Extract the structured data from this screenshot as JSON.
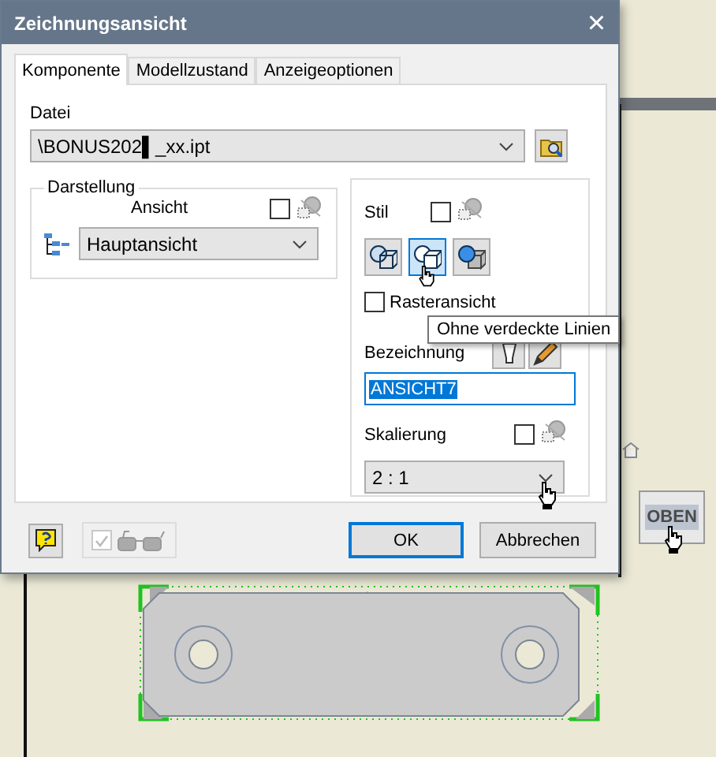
{
  "window": {
    "title": "Zeichnungsansicht",
    "close": "×"
  },
  "tabs": [
    {
      "label": "Komponente",
      "selected": true
    },
    {
      "label": "Modellzustand",
      "selected": false
    },
    {
      "label": "Anzeigeoptionen",
      "selected": false
    }
  ],
  "datei": {
    "label": "Datei",
    "value": "\\BONUS202▌_xx.ipt"
  },
  "darstellung": {
    "legend": "Darstellung",
    "ansicht_label": "Ansicht",
    "ansicht_linked": false,
    "ansicht_value": "Hauptansicht"
  },
  "stil": {
    "label": "Stil",
    "linked": false,
    "style_buttons": [
      {
        "selected": false
      },
      {
        "selected": true
      },
      {
        "selected": false
      }
    ],
    "raster": {
      "label": "Rasteransicht",
      "checked": false
    },
    "tooltip": "Ohne verdeckte Linien"
  },
  "bezeichnung": {
    "label": "Bezeichnung",
    "value": "ANSICHT7",
    "text_selected": true
  },
  "skalierung": {
    "label": "Skalierung",
    "linked": false,
    "value": "2 : 1"
  },
  "preview": {
    "checked": true,
    "disabled": true
  },
  "buttons": [
    {
      "label": "OK",
      "default": true
    },
    {
      "label": "Abbrechen",
      "default": false
    }
  ],
  "canvas": {
    "view_cube_label": "OBEN"
  }
}
